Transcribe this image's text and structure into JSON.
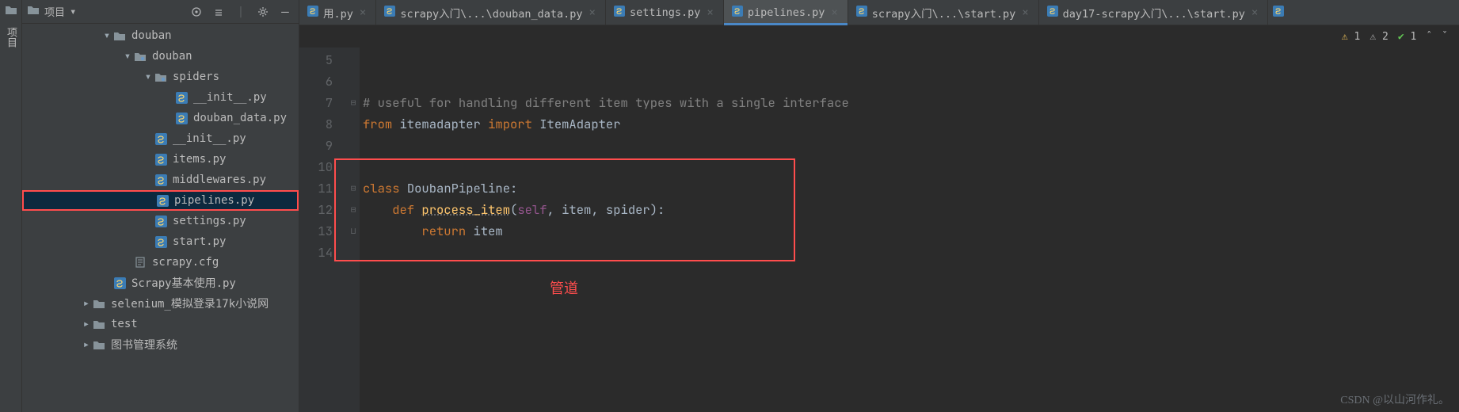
{
  "rail": {
    "label": "项目"
  },
  "sidebar": {
    "title": "项目",
    "tree": {
      "douban_root": "douban",
      "douban_pkg": "douban",
      "spiders": "spiders",
      "init_spiders": "__init__.py",
      "douban_data": "douban_data.py",
      "init_pkg": "__init__.py",
      "items": "items.py",
      "middlewares": "middlewares.py",
      "pipelines": "pipelines.py",
      "settings": "settings.py",
      "start": "start.py",
      "scrapy_cfg": "scrapy.cfg",
      "scrapy_basic": "Scrapy基本使用.py",
      "selenium": "selenium_模拟登录17k小说网",
      "test": "test",
      "book_mgmt": "图书管理系统"
    }
  },
  "tabs": {
    "t0": "用.py",
    "t1": "scrapy入门\\...\\douban_data.py",
    "t2": "settings.py",
    "t3": "pipelines.py",
    "t4": "scrapy入门\\...\\start.py",
    "t5": "day17-scrapy入门\\...\\start.py"
  },
  "status": {
    "w_val": "1",
    "e_val": "2",
    "ok_val": "1"
  },
  "code": {
    "l7": "# useful for handling different item types with a single interface",
    "l8a": "from",
    "l8b": " itemadapter ",
    "l8c": "import",
    "l8d": " ItemAdapter",
    "l11a": "class ",
    "l11b": "DoubanPipeline",
    "l11c": ":",
    "l12a": "    def ",
    "l12b": "process_item",
    "l12c": "(",
    "l12d": "self",
    "l12e": ", item, spider):",
    "l13a": "        return ",
    "l13b": "item"
  },
  "gutter": {
    "l5": "5",
    "l6": "6",
    "l7": "7",
    "l8": "8",
    "l9": "9",
    "l10": "10",
    "l11": "11",
    "l12": "12",
    "l13": "13",
    "l14": "14"
  },
  "annotation": {
    "pipe_label": "管道"
  },
  "watermark": "CSDN @以山河作礼。"
}
